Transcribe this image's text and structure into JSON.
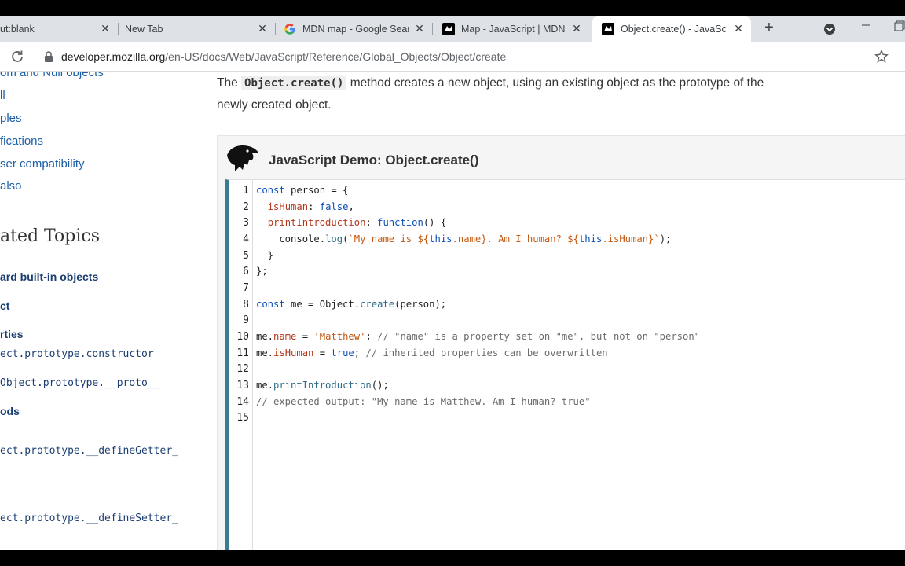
{
  "tabs": [
    {
      "title": "ut:blank",
      "close": "✕"
    },
    {
      "title": "New Tab",
      "close": "✕"
    },
    {
      "title": "MDN map - Google Search",
      "close": "✕"
    },
    {
      "title": "Map - JavaScript | MDN",
      "close": "✕"
    },
    {
      "title": "Object.create() - JavaScript | MDN",
      "close": "✕"
    }
  ],
  "toolbar": {
    "url_host": "developer.mozilla.org",
    "url_path": "/en-US/docs/Web/JavaScript/Reference/Global_Objects/Object/create"
  },
  "sidebar": {
    "links": [
      "om and Null objects",
      "ll",
      "ples",
      "fications",
      "ser compatibility",
      "also"
    ],
    "related_heading": "ated Topics",
    "standard_objects": "ard built-in objects",
    "object_link": "ct",
    "properties_heading": "rties",
    "prop_constructor": "ect.prototype.constructor",
    "prop_proto": "Object.prototype.__proto__",
    "methods_heading": "ods",
    "method_define_getter": "ect.prototype.__defineGetter_",
    "method_define_setter": "ect.prototype.__defineSetter_"
  },
  "content": {
    "intro_prefix": "The ",
    "intro_code": "Object.create()",
    "intro_rest": " method creates a new object, using an existing object as the prototype of the newly created object.",
    "demo_title": "JavaScript Demo: Object.create()",
    "line_numbers": [
      "1",
      "2",
      "3",
      "4",
      "5",
      "6",
      "7",
      "8",
      "9",
      "10",
      "11",
      "12",
      "13",
      "14",
      "15"
    ]
  },
  "colors": {
    "link": "#1b5fa8",
    "editor_accent": "#3a7b94",
    "keyword": "#0a4fb7",
    "string": "#c2580f",
    "comment": "#6a6a6a"
  }
}
